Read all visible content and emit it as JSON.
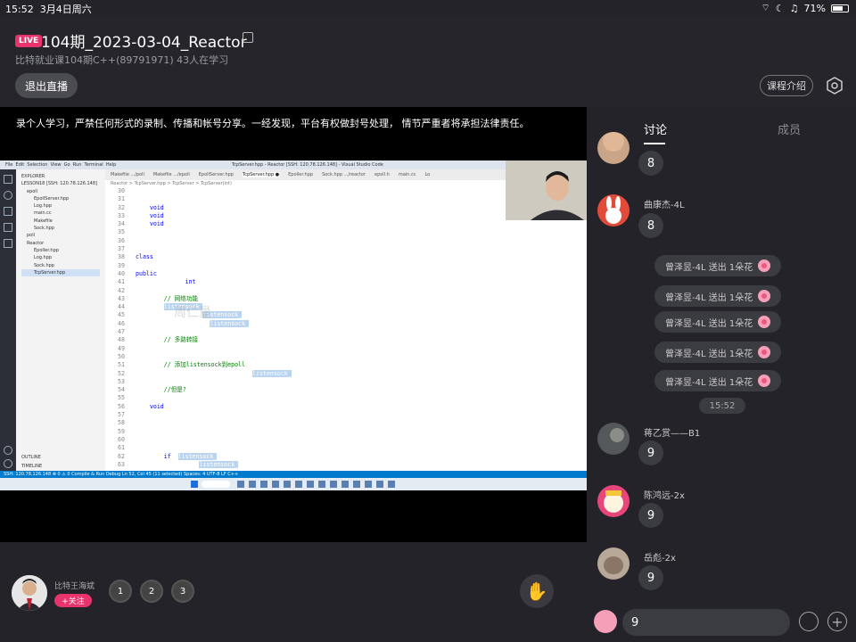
{
  "status": {
    "time": "15:52",
    "date": "3月4日周六",
    "battery": "71%",
    "battery_level": 0.71
  },
  "header": {
    "live_badge": "LIVE",
    "title": "104期_2023-03-04_Reactor",
    "subtitle": "比特就业课104期C++(89791971)  43人在学习",
    "exit_label": "退出直播",
    "course_label": "课程介绍"
  },
  "video": {
    "notice": "录个人学习，严禁任何形式的录制、传播和帐号分享。一经发现，平台有权做封号处理， 情节严重者将承担法律责任。",
    "watermark": "周仁量",
    "vs_title": "TcpServer.hpp - Reactor [SSH: 120.78.126.148] - Visual Studio Code",
    "vs_status": "SSH: 120.78.126.148   ⊗ 0 ⚠ 0   Compile & Run   Debug      Ln 52, Col 45 (11 selected)  Spaces: 4  UTF-8  LF  C++",
    "sidebar_items": [
      "EXPLORER",
      "LESSON18 [SSH: 120.78.126.148]",
      "epoll",
      "EpollServer.hpp",
      "Log.hpp",
      "main.cc",
      "Makefile",
      "Sock.hpp",
      "poll",
      "Reactor",
      "Epoller.hpp",
      "Log.hpp",
      "Sock.hpp",
      "TcpServer.hpp"
    ],
    "tabs": [
      "Makefile .../poll",
      "Makefile .../epoll",
      "EpollServer.hpp",
      "TcpServer.hpp ●",
      "Epoller.hpp",
      "Sock.hpp .../reactor",
      "epoll.h",
      "main.cc",
      "Lo"
    ],
    "breadcrumb": "Reactor > TcpServer.hpp > TcpServer > TcpServer(int)",
    "code_lines": [
      {
        "n": "30",
        "t": "    {"
      },
      {
        "n": "31",
        "t": "    }"
      },
      {
        "n": "32",
        "t": "    void SetRecver(func_t recver) { recver_ = recver; }"
      },
      {
        "n": "33",
        "t": "    void SetSender(func_t sender) { sender_ = sender; }"
      },
      {
        "n": "34",
        "t": "    void SetExcepter(func_t excepter) { excepter_ = excepter; }"
      },
      {
        "n": "35",
        "t": "    ~Connection() {}"
      },
      {
        "n": "36",
        "t": "};"
      },
      {
        "n": "37",
        "t": ""
      },
      {
        "n": "38",
        "t": "class TcpServer"
      },
      {
        "n": "39",
        "t": "{"
      },
      {
        "n": "40",
        "t": "public:"
      },
      {
        "n": "41",
        "t": "    TcpServer(int port = 8080)"
      },
      {
        "n": "42",
        "t": "    {"
      },
      {
        "n": "43",
        "t": "        // 网络功能"
      },
      {
        "n": "44",
        "t": "        listensock_ = Sock::Socket();"
      },
      {
        "n": "45",
        "t": "        Sock::Bind(listensock_, port);"
      },
      {
        "n": "46",
        "t": "        Sock::Listen(listensock_);"
      },
      {
        "n": "47",
        "t": ""
      },
      {
        "n": "48",
        "t": "        // 多路转接"
      },
      {
        "n": "49",
        "t": "        epfd_ = Epoller::CreateEpoller();"
      },
      {
        "n": "50",
        "t": ""
      },
      {
        "n": "51",
        "t": "        // 添加listensock到epoll"
      },
      {
        "n": "52",
        "t": "        Epoller::AddEvent(epfd_, listensock_, EPOLLIN|EPOLLET);"
      },
      {
        "n": "53",
        "t": ""
      },
      {
        "n": "54",
        "t": "        //但是?"
      },
      {
        "n": "55",
        "t": "    }"
      },
      {
        "n": "56",
        "t": "    void Dispatcher()"
      },
      {
        "n": "57",
        "t": "    {"
      },
      {
        "n": "58",
        "t": ""
      },
      {
        "n": "59",
        "t": "    }"
      },
      {
        "n": "60",
        "t": "    ~TcpServer()"
      },
      {
        "n": "61",
        "t": "    {"
      },
      {
        "n": "62",
        "t": "        if (listensock_ != -1)"
      },
      {
        "n": "63",
        "t": "            close(listensock_);"
      }
    ]
  },
  "bottom": {
    "host_name": "比特王海斌",
    "follow_label": "+关注",
    "ranks": [
      "1",
      "2",
      "3"
    ]
  },
  "panel": {
    "tab_discuss": "讨论",
    "tab_members": "成员",
    "time_chip": "15:52",
    "messages": [
      {
        "name": "",
        "text": "8"
      },
      {
        "name": "曲康杰-4L",
        "text": "8"
      },
      {
        "name": "蒋乙赏——B1",
        "text": "9"
      },
      {
        "name": "陈鸿远-2x",
        "text": "9"
      },
      {
        "name": "岳彪-2x",
        "text": "9"
      }
    ],
    "gifts": [
      "曾泽昱-4L 送出 1朵花",
      "曾泽昱-4L 送出 1朵花",
      "曾泽昱-4L 送出 1朵花",
      "曾泽昱-4L 送出 1朵花",
      "曾泽昱-4L 送出 1朵花"
    ]
  },
  "input": {
    "value": "9"
  }
}
